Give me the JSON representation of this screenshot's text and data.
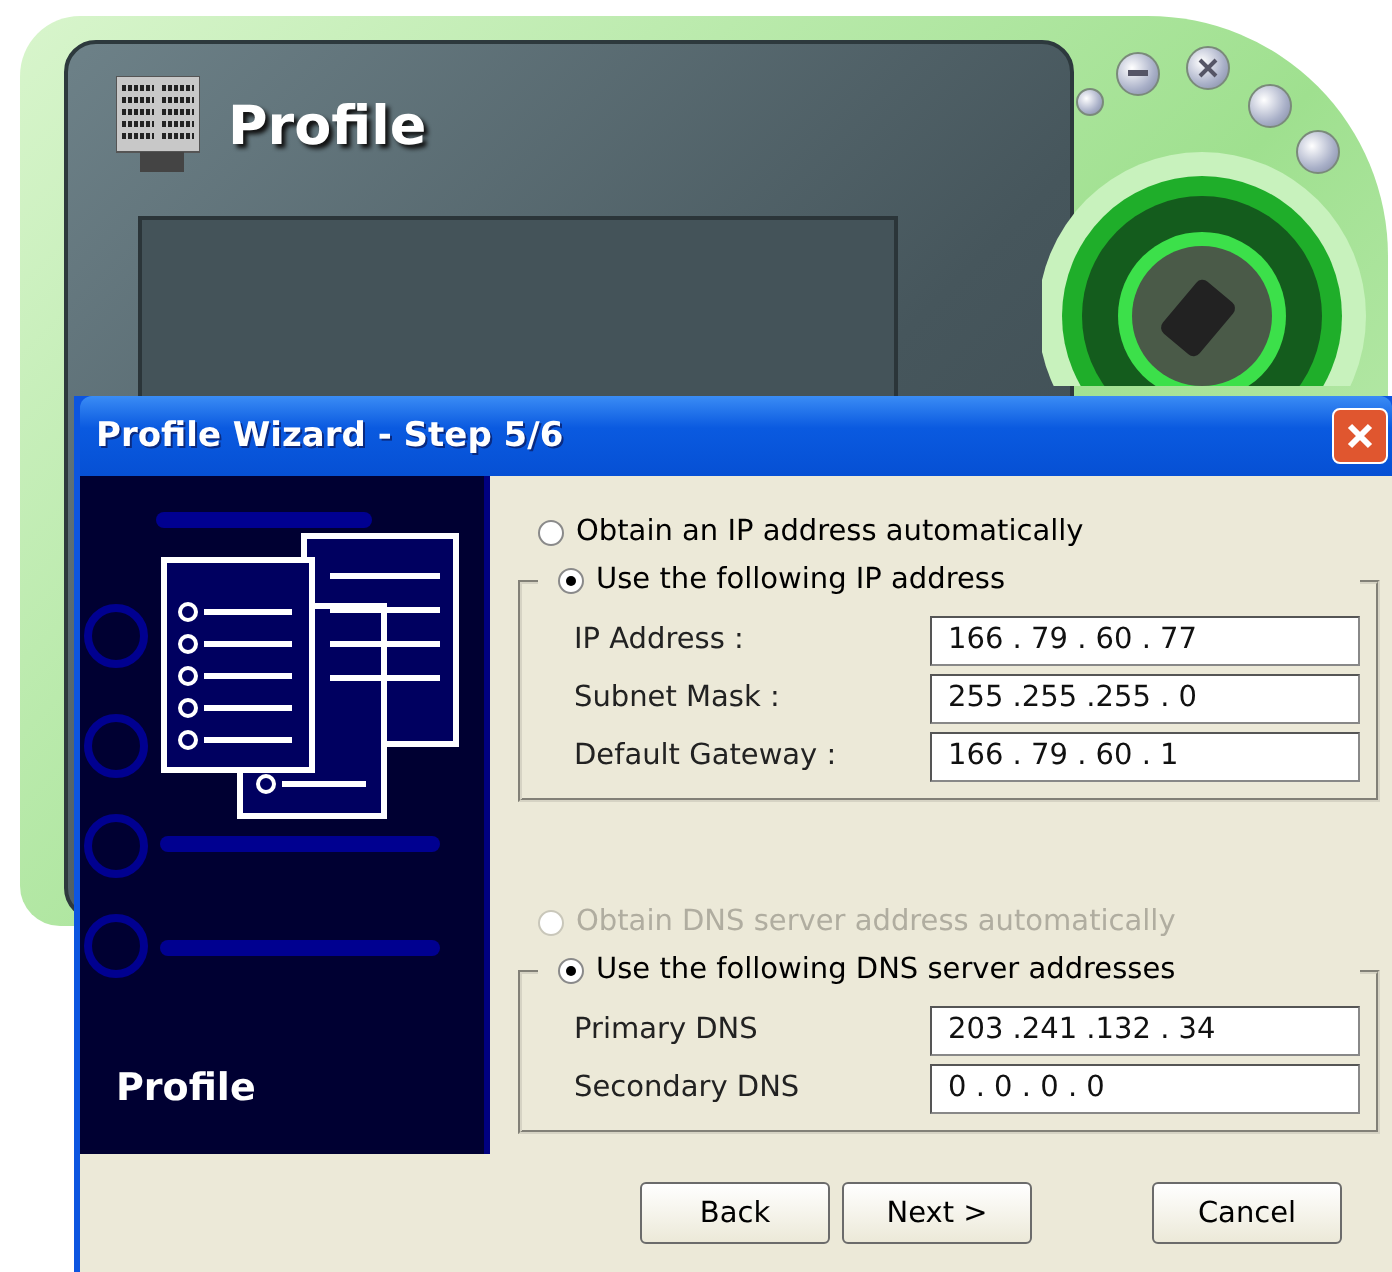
{
  "skin_window": {
    "title": "Profile"
  },
  "dialog": {
    "title": "Profile Wizard - Step 5/6",
    "sidebar_label": "Profile",
    "sections": [
      {
        "options": [
          {
            "label": "Obtain an IP address automatically",
            "selected": false,
            "disabled": false
          },
          {
            "label": "Use the following IP address",
            "selected": true,
            "disabled": false
          }
        ],
        "fields": [
          {
            "label": "IP Address :",
            "value": "166 . 79 . 60 . 77"
          },
          {
            "label": "Subnet Mask :",
            "value": "255 .255 .255 . 0"
          },
          {
            "label": "Default Gateway :",
            "value": "166 . 79 . 60 . 1"
          }
        ]
      },
      {
        "options": [
          {
            "label": "Obtain DNS server address automatically",
            "selected": false,
            "disabled": true
          },
          {
            "label": "Use the following DNS server addresses",
            "selected": true,
            "disabled": false
          }
        ],
        "fields": [
          {
            "label": "Primary DNS",
            "value": "203 .241 .132 . 34"
          },
          {
            "label": "Secondary DNS",
            "value": "0 . 0 . 0 . 0"
          }
        ]
      }
    ],
    "buttons": [
      {
        "label": "Back"
      },
      {
        "label": "Next >"
      },
      {
        "label": "Cancel"
      }
    ]
  }
}
